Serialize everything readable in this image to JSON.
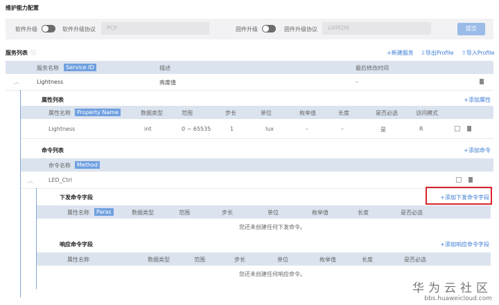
{
  "title": "维护能力配置",
  "maint": {
    "software_upgrade": "软件升级",
    "software_protocol_label": "软件升级协议",
    "software_protocol_value": "PCP",
    "firmware_upgrade": "固件升级",
    "firmware_protocol_label": "固件升级协议",
    "firmware_protocol_value": "LWM2M",
    "submit": "提交",
    "software_toggle_on": false,
    "firmware_toggle_on": false
  },
  "services": {
    "title": "服务列表",
    "new_service": "+新建服务",
    "export": "⇩导出Profile",
    "import": "⇧导入Profile",
    "headers": [
      "服务名称",
      "Service ID",
      "描述",
      "最后修改时间"
    ],
    "row": {
      "name": "Lightness",
      "desc": "亮度值",
      "modified": "–"
    }
  },
  "properties": {
    "title": "属性列表",
    "add": "+添加属性",
    "headers": [
      "属性名称",
      "Property Name",
      "数据类型",
      "范围",
      "步长",
      "单位",
      "枚举值",
      "长度",
      "是否必选",
      "访问模式"
    ],
    "row": [
      "Lightness",
      "int",
      "0 ~ 65535",
      "1",
      "lux",
      "–",
      "–",
      "是",
      "R"
    ]
  },
  "commands": {
    "title": "命令列表",
    "add": "+添加命令",
    "headers": [
      "命令名称",
      "Method"
    ],
    "row": {
      "name": "LED_Ctrl"
    }
  },
  "down": {
    "title": "下发命令字段",
    "add": "+添加下发命令字段",
    "headers": [
      "属性名称",
      "Paras",
      "数据类型",
      "范围",
      "步长",
      "单位",
      "枚举值",
      "长度",
      "是否必选"
    ],
    "empty": "您还未创建任何下发命令。"
  },
  "resp": {
    "title": "响应命令字段",
    "add": "+添加响应命令字段",
    "headers": [
      "属性名称",
      "数据类型",
      "范围",
      "步长",
      "单位",
      "枚举值",
      "长度",
      "是否必选"
    ],
    "empty": "您还未创建任何响应命令。"
  },
  "watermark": {
    "name": "华为云社区",
    "url": "bbs.huaweicloud.com"
  },
  "colors": {
    "accent": "#3a7bd5",
    "tag": "#6fa0e0",
    "header": "#dbe3ee",
    "highlight": "#d9232b"
  }
}
